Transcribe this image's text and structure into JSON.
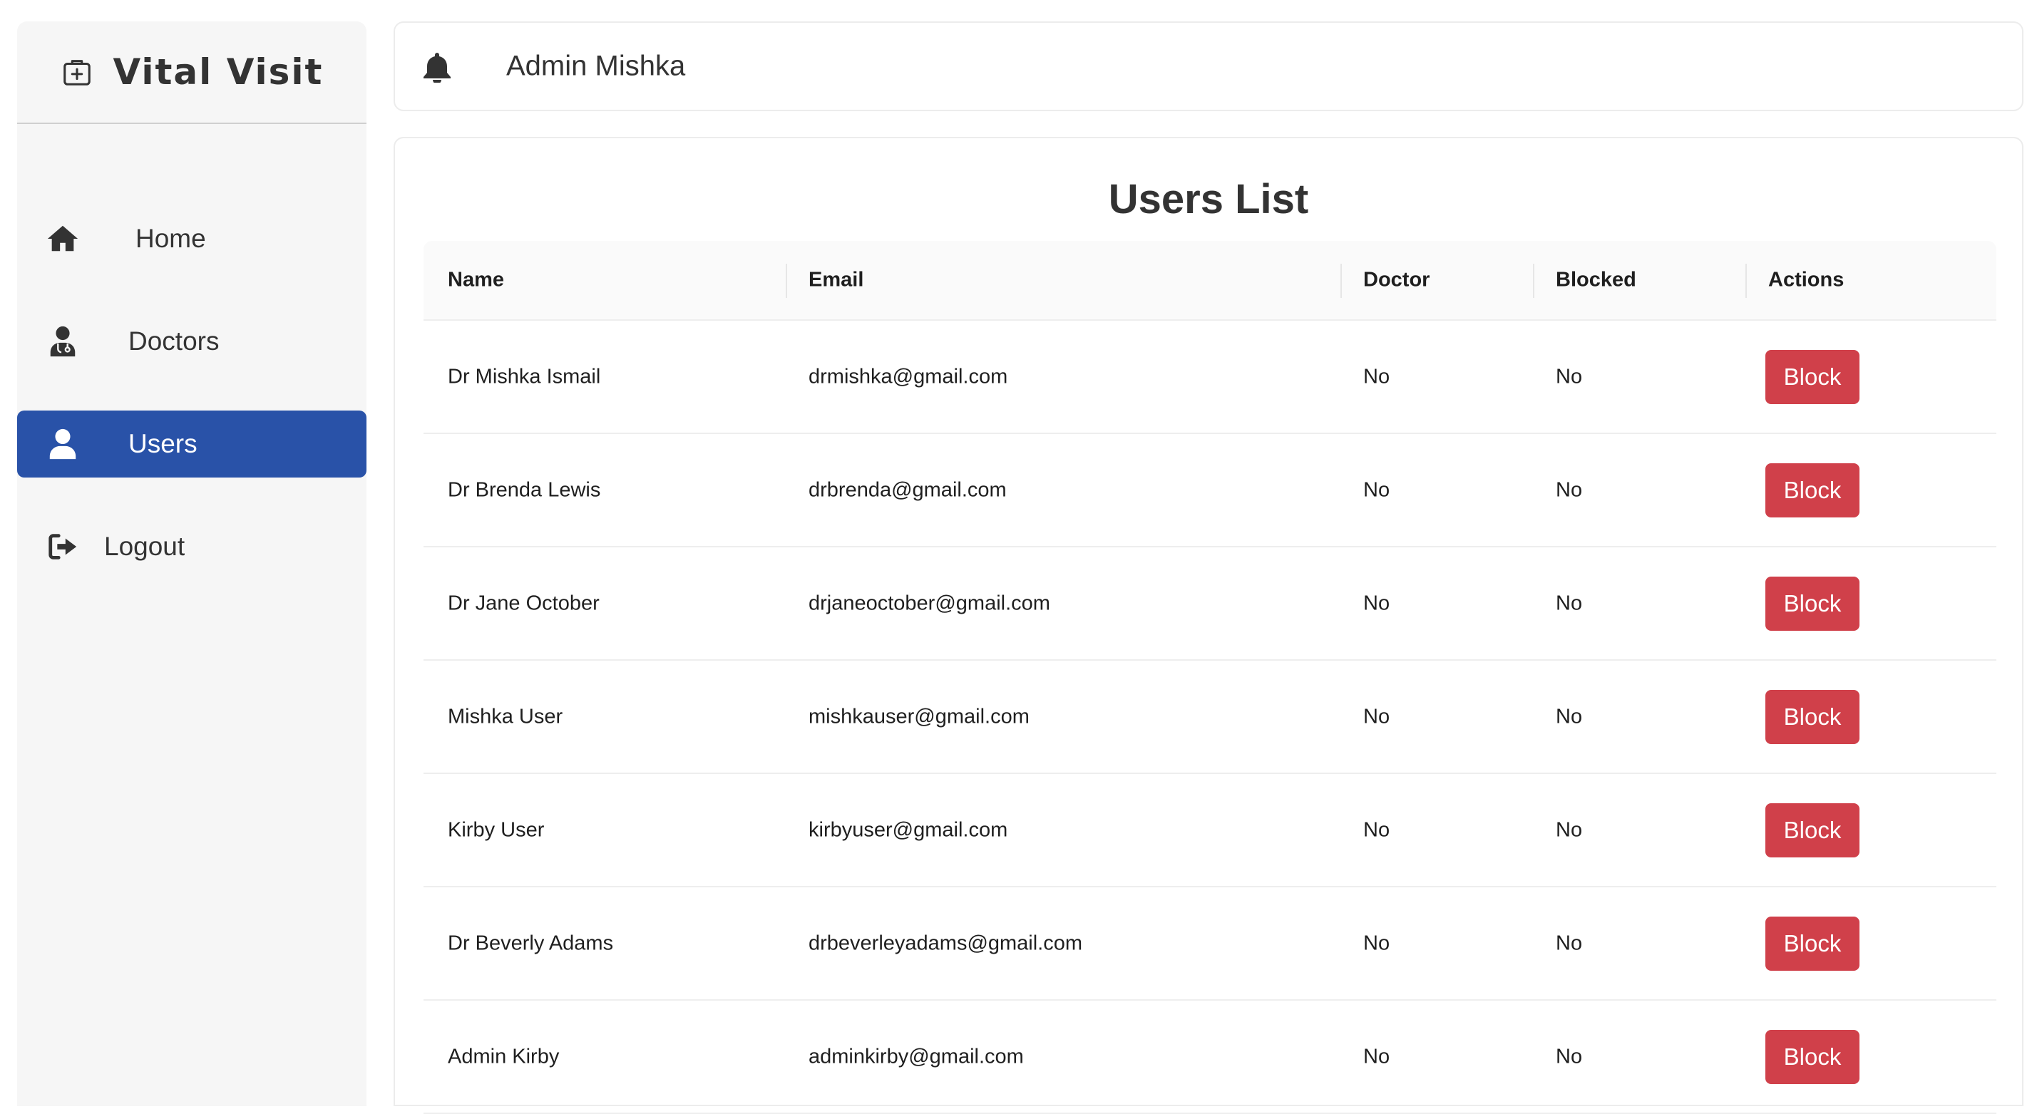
{
  "brand": {
    "title": "Vital Visit",
    "icon": "medical-kit-icon"
  },
  "sidebar": {
    "items": [
      {
        "label": "Home",
        "icon": "home-icon",
        "active": false
      },
      {
        "label": "Doctors",
        "icon": "doctor-icon",
        "active": false
      },
      {
        "label": "Users",
        "icon": "user-icon",
        "active": true
      },
      {
        "label": "Logout",
        "icon": "logout-icon",
        "active": false
      }
    ]
  },
  "header": {
    "admin_name": "Admin Mishka",
    "icon": "bell-icon"
  },
  "main": {
    "title": "Users List",
    "columns": {
      "name": "Name",
      "email": "Email",
      "doctor": "Doctor",
      "blocked": "Blocked",
      "actions": "Actions"
    },
    "rows": [
      {
        "name": "Dr Mishka Ismail",
        "email": "drmishka@gmail.com",
        "doctor": "No",
        "blocked": "No",
        "action": "Block"
      },
      {
        "name": "Dr Brenda Lewis",
        "email": "drbrenda@gmail.com",
        "doctor": "No",
        "blocked": "No",
        "action": "Block"
      },
      {
        "name": "Dr Jane October",
        "email": "drjaneoctober@gmail.com",
        "doctor": "No",
        "blocked": "No",
        "action": "Block"
      },
      {
        "name": "Mishka User",
        "email": "mishkauser@gmail.com",
        "doctor": "No",
        "blocked": "No",
        "action": "Block"
      },
      {
        "name": "Kirby User",
        "email": "kirbyuser@gmail.com",
        "doctor": "No",
        "blocked": "No",
        "action": "Block"
      },
      {
        "name": "Dr Beverly Adams",
        "email": "drbeverleyadams@gmail.com",
        "doctor": "No",
        "blocked": "No",
        "action": "Block"
      },
      {
        "name": "Admin Kirby",
        "email": "adminkirby@gmail.com",
        "doctor": "No",
        "blocked": "No",
        "action": "Block"
      }
    ]
  },
  "colors": {
    "accent": "#2952a8",
    "danger": "#d0404a",
    "sidebar_bg": "#f6f6f6"
  }
}
